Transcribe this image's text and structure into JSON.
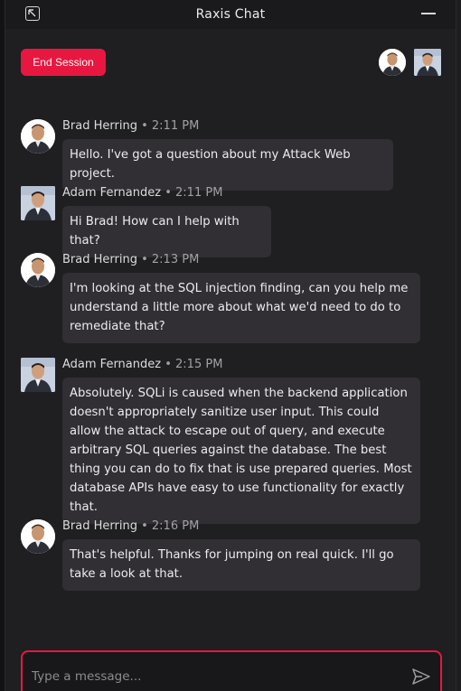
{
  "window": {
    "title": "Raxis Chat"
  },
  "actions": {
    "end_session": "End Session"
  },
  "participants": [
    {
      "name": "Brad Herring",
      "avatar": "round"
    },
    {
      "name": "Adam Fernandez",
      "avatar": "square"
    }
  ],
  "messages": [
    {
      "author": "Brad Herring",
      "separator": "•",
      "time": "2:11 PM",
      "text": "Hello. I've got a question about my Attack Web project."
    },
    {
      "author": "Adam Fernandez",
      "separator": "•",
      "time": "2:11 PM",
      "text": "Hi Brad! How can I help with that?"
    },
    {
      "author": "Brad Herring",
      "separator": "•",
      "time": "2:13 PM",
      "text": "I'm looking at the SQL injection finding, can you help me understand a little more about what we'd need to do to remediate that?"
    },
    {
      "author": "Adam Fernandez",
      "separator": "•",
      "time": "2:15 PM",
      "text": "Absolutely. SQLi is caused when the backend application doesn't appropriately sanitize user input. This could allow the attack to escape out of query, and execute arbitrary SQL queries against the database. The best thing you can do to fix that is use prepared queries. Most database APIs have easy to use functionality for exactly that."
    },
    {
      "author": "Brad Herring",
      "separator": "•",
      "time": "2:16 PM",
      "text": "That's helpful. Thanks for jumping on real quick. I'll go take a look at that."
    }
  ],
  "composer": {
    "placeholder": "Type a message..."
  },
  "colors": {
    "accent": "#e8173f",
    "bubble": "#312f33",
    "background": "#1f1e21"
  },
  "icons": {
    "expand": "expand-icon",
    "minimize": "minimize-icon",
    "send": "send-icon"
  }
}
